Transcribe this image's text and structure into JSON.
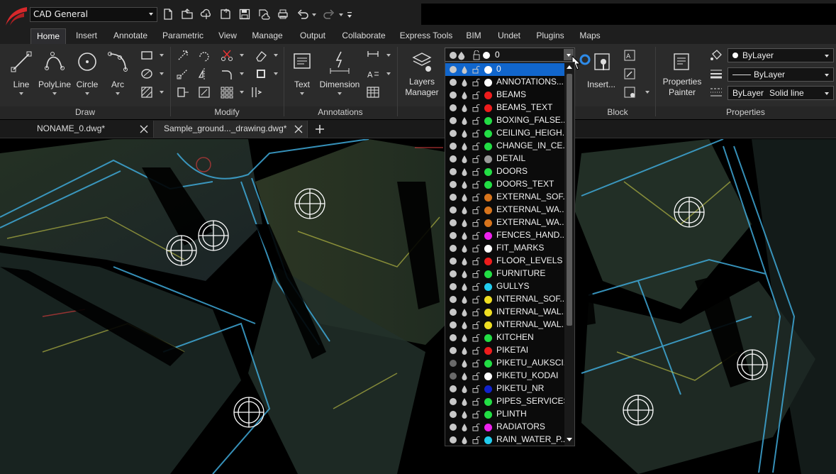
{
  "workspace": {
    "label": "CAD General"
  },
  "ribbon_tabs": [
    "Home",
    "Insert",
    "Annotate",
    "Parametric",
    "View",
    "Manage",
    "Output",
    "Collaborate",
    "Express Tools",
    "BIM",
    "Undet",
    "Plugins",
    "Maps"
  ],
  "active_tab": "Home",
  "draw": {
    "title": "Draw",
    "line": "Line",
    "polyline": "PolyLine",
    "circle": "Circle",
    "arc": "Arc"
  },
  "modify": {
    "title": "Modify"
  },
  "annotations": {
    "title": "Annotations",
    "text": "Text",
    "dimension": "Dimension"
  },
  "layers": {
    "manager_label_1": "Layers",
    "manager_label_2": "Manager",
    "current": "0"
  },
  "block": {
    "title": "Block",
    "insert": "Insert..."
  },
  "properties": {
    "title": "Properties",
    "painter_1": "Properties",
    "painter_2": "Painter",
    "color": "ByLayer",
    "lineweight": "ByLayer",
    "linetype_layer": "ByLayer",
    "linetype": "Solid line"
  },
  "doc_tabs": [
    "NONAME_0.dwg*",
    "Sample_ground..._drawing.dwg*"
  ],
  "colors": {
    "accent": "#1166cc",
    "ribbon_bg": "#2b2b2b",
    "logo_red": "#d8282b"
  },
  "layer_list": [
    {
      "name": "0",
      "color": "#ffffff",
      "on": true
    },
    {
      "name": "ANNOTATIONS...",
      "color": "#ffffff",
      "on": true
    },
    {
      "name": "BEAMS",
      "color": "#ee1c1c",
      "on": true
    },
    {
      "name": "BEAMS_TEXT",
      "color": "#ee1c1c",
      "on": true
    },
    {
      "name": "BOXING_FALSE...",
      "color": "#22dd44",
      "on": true
    },
    {
      "name": "CEILING_HEIGH...",
      "color": "#22dd44",
      "on": true
    },
    {
      "name": "CHANGE_IN_CE...",
      "color": "#22dd44",
      "on": true
    },
    {
      "name": "DETAIL",
      "color": "#9a9a9a",
      "on": true
    },
    {
      "name": "DOORS",
      "color": "#22dd44",
      "on": true
    },
    {
      "name": "DOORS_TEXT",
      "color": "#22dd44",
      "on": true
    },
    {
      "name": "EXTERNAL_SOF...",
      "color": "#d7741c",
      "on": true
    },
    {
      "name": "EXTERNAL_WA...",
      "color": "#d7741c",
      "on": true
    },
    {
      "name": "EXTERNAL_WA...",
      "color": "#d7741c",
      "on": true
    },
    {
      "name": "FENCES_HAND...",
      "color": "#ee22ee",
      "on": true
    },
    {
      "name": "FIT_MARKS",
      "color": "#ffffff",
      "on": true
    },
    {
      "name": "FLOOR_LEVELS",
      "color": "#ee1c1c",
      "on": true
    },
    {
      "name": "FURNITURE",
      "color": "#22dd44",
      "on": true
    },
    {
      "name": "GULLYS",
      "color": "#22ccee",
      "on": true
    },
    {
      "name": "INTERNAL_SOF...",
      "color": "#eedd22",
      "on": true
    },
    {
      "name": "INTERNAL_WAL...",
      "color": "#eedd22",
      "on": true
    },
    {
      "name": "INTERNAL_WAL...",
      "color": "#eedd22",
      "on": true
    },
    {
      "name": "KITCHEN",
      "color": "#22dd44",
      "on": true
    },
    {
      "name": "PIKETAI",
      "color": "#ee1c1c",
      "on": true
    },
    {
      "name": "PIKETU_AUKSCI...",
      "color": "#22dd44",
      "on": false
    },
    {
      "name": "PIKETU_KODAI",
      "color": "#ffffff",
      "on": false
    },
    {
      "name": "PIKETU_NR",
      "color": "#1122cc",
      "on": true
    },
    {
      "name": "PIPES_SERVICES",
      "color": "#22dd44",
      "on": true
    },
    {
      "name": "PLINTH",
      "color": "#22dd44",
      "on": true
    },
    {
      "name": "RADIATORS",
      "color": "#ee22ee",
      "on": true
    },
    {
      "name": "RAIN_WATER_P...",
      "color": "#22ccee",
      "on": true
    }
  ]
}
